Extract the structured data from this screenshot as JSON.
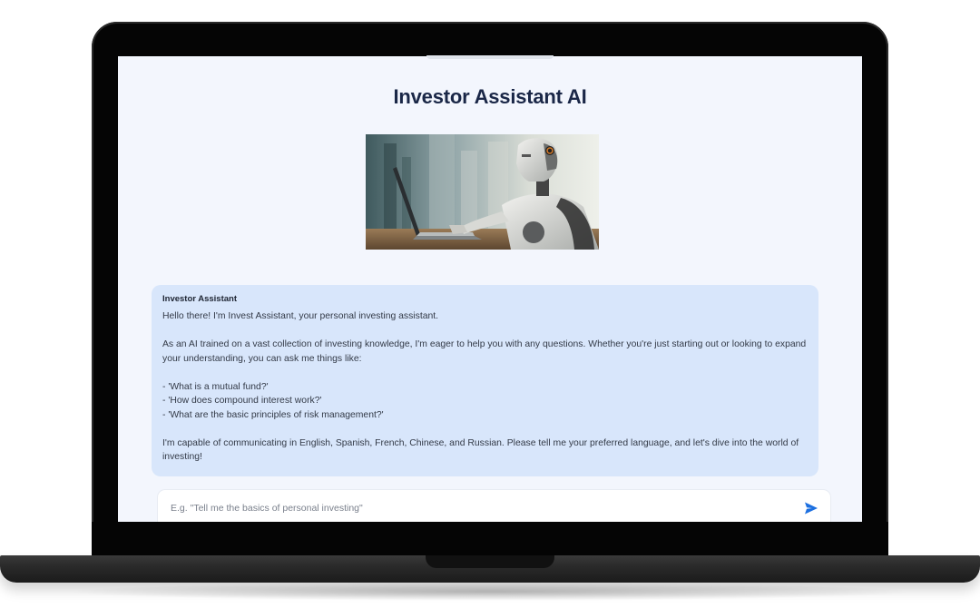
{
  "app": {
    "title": "Investor Assistant AI"
  },
  "hero": {
    "icon": "robot-laptop-illustration"
  },
  "chat": {
    "messages": [
      {
        "sender": "Investor Assistant",
        "lines": {
          "greeting": "Hello there! I'm Invest Assistant, your personal investing assistant.",
          "intro": "As an AI trained on a vast collection of investing knowledge, I'm eager to help you with any questions. Whether you're just starting out or looking to expand your understanding, you can ask me things like:",
          "example1": "- 'What is a mutual fund?'",
          "example2": "- 'How does compound interest work?'",
          "example3": "- 'What are the basic principles of risk management?'",
          "languages": "I'm capable of communicating in English, Spanish, French, Chinese, and Russian. Please tell me your preferred language, and let's dive into the world of investing!"
        }
      }
    ]
  },
  "composer": {
    "placeholder": "E.g. \"Tell me the basics of personal investing\"",
    "value": "",
    "send_icon": "send-icon"
  },
  "colors": {
    "screen_bg": "#f3f6fd",
    "bubble_bg": "#d8e6fb",
    "title": "#1a2747",
    "accent": "#1c6fe0"
  }
}
